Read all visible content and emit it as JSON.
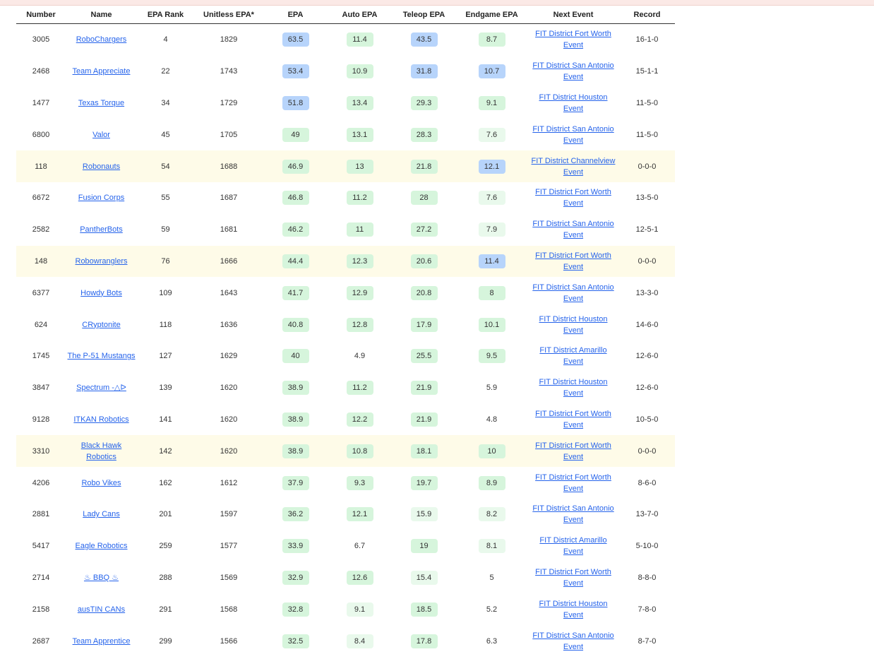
{
  "headers": {
    "number": "Number",
    "name": "Name",
    "epa_rank": "EPA Rank",
    "unitless_epa": "Unitless EPA*",
    "epa": "EPA",
    "auto_epa": "Auto EPA",
    "teleop_epa": "Teleop EPA",
    "endgame_epa": "Endgame EPA",
    "next_event": "Next Event",
    "record": "Record"
  },
  "colors": {
    "chip_blue": "#b7d4fb",
    "chip_green": "#d6f5dc",
    "chip_light_green": "#e9f9ec",
    "link": "#2563eb",
    "highlight_row": "#fefbe8"
  },
  "rows": [
    {
      "number": "3005",
      "name": "RoboChargers",
      "rank": "4",
      "unitless": "1829",
      "epa": "63.5",
      "epa_c": "blue",
      "auto": "11.4",
      "auto_c": "green",
      "teleop": "43.5",
      "teleop_c": "blue",
      "endgame": "8.7",
      "endgame_c": "green",
      "event": "FIT District Fort Worth Event",
      "record": "16-1-0",
      "hl": false
    },
    {
      "number": "2468",
      "name": "Team Appreciate",
      "rank": "22",
      "unitless": "1743",
      "epa": "53.4",
      "epa_c": "blue",
      "auto": "10.9",
      "auto_c": "green",
      "teleop": "31.8",
      "teleop_c": "blue",
      "endgame": "10.7",
      "endgame_c": "blue",
      "event": "FIT District San Antonio Event",
      "record": "15-1-1",
      "hl": false
    },
    {
      "number": "1477",
      "name": "Texas Torque",
      "rank": "34",
      "unitless": "1729",
      "epa": "51.8",
      "epa_c": "blue",
      "auto": "13.4",
      "auto_c": "green",
      "teleop": "29.3",
      "teleop_c": "green",
      "endgame": "9.1",
      "endgame_c": "green",
      "event": "FIT District Houston Event",
      "record": "11-5-0",
      "hl": false
    },
    {
      "number": "6800",
      "name": "Valor",
      "rank": "45",
      "unitless": "1705",
      "epa": "49",
      "epa_c": "green",
      "auto": "13.1",
      "auto_c": "green",
      "teleop": "28.3",
      "teleop_c": "green",
      "endgame": "7.6",
      "endgame_c": "lgreen",
      "event": "FIT District San Antonio Event",
      "record": "11-5-0",
      "hl": false
    },
    {
      "number": "118",
      "name": "Robonauts",
      "rank": "54",
      "unitless": "1688",
      "epa": "46.9",
      "epa_c": "green",
      "auto": "13",
      "auto_c": "green",
      "teleop": "21.8",
      "teleop_c": "green",
      "endgame": "12.1",
      "endgame_c": "blue",
      "event": "FIT District Channelview Event",
      "record": "0-0-0",
      "hl": true
    },
    {
      "number": "6672",
      "name": "Fusion Corps",
      "rank": "55",
      "unitless": "1687",
      "epa": "46.8",
      "epa_c": "green",
      "auto": "11.2",
      "auto_c": "green",
      "teleop": "28",
      "teleop_c": "green",
      "endgame": "7.6",
      "endgame_c": "lgreen",
      "event": "FIT District Fort Worth Event",
      "record": "13-5-0",
      "hl": false
    },
    {
      "number": "2582",
      "name": "PantherBots",
      "rank": "59",
      "unitless": "1681",
      "epa": "46.2",
      "epa_c": "green",
      "auto": "11",
      "auto_c": "green",
      "teleop": "27.2",
      "teleop_c": "green",
      "endgame": "7.9",
      "endgame_c": "lgreen",
      "event": "FIT District San Antonio Event",
      "record": "12-5-1",
      "hl": false
    },
    {
      "number": "148",
      "name": "Robowranglers",
      "rank": "76",
      "unitless": "1666",
      "epa": "44.4",
      "epa_c": "green",
      "auto": "12.3",
      "auto_c": "green",
      "teleop": "20.6",
      "teleop_c": "green",
      "endgame": "11.4",
      "endgame_c": "blue",
      "event": "FIT District Fort Worth Event",
      "record": "0-0-0",
      "hl": true
    },
    {
      "number": "6377",
      "name": "Howdy Bots",
      "rank": "109",
      "unitless": "1643",
      "epa": "41.7",
      "epa_c": "green",
      "auto": "12.9",
      "auto_c": "green",
      "teleop": "20.8",
      "teleop_c": "green",
      "endgame": "8",
      "endgame_c": "green",
      "event": "FIT District San Antonio Event",
      "record": "13-3-0",
      "hl": false
    },
    {
      "number": "624",
      "name": "CRyptonite",
      "rank": "118",
      "unitless": "1636",
      "epa": "40.8",
      "epa_c": "green",
      "auto": "12.8",
      "auto_c": "green",
      "teleop": "17.9",
      "teleop_c": "green",
      "endgame": "10.1",
      "endgame_c": "green",
      "event": "FIT District Houston Event",
      "record": "14-6-0",
      "hl": false
    },
    {
      "number": "1745",
      "name": "The P-51 Mustangs",
      "rank": "127",
      "unitless": "1629",
      "epa": "40",
      "epa_c": "green",
      "auto": "4.9",
      "auto_c": "none",
      "teleop": "25.5",
      "teleop_c": "green",
      "endgame": "9.5",
      "endgame_c": "green",
      "event": "FIT District Amarillo Event",
      "record": "12-6-0",
      "hl": false
    },
    {
      "number": "3847",
      "name": "Spectrum -△ᐅ",
      "rank": "139",
      "unitless": "1620",
      "epa": "38.9",
      "epa_c": "green",
      "auto": "11.2",
      "auto_c": "green",
      "teleop": "21.9",
      "teleop_c": "green",
      "endgame": "5.9",
      "endgame_c": "none",
      "event": "FIT District Houston Event",
      "record": "12-6-0",
      "hl": false
    },
    {
      "number": "9128",
      "name": "ITKAN Robotics",
      "rank": "141",
      "unitless": "1620",
      "epa": "38.9",
      "epa_c": "green",
      "auto": "12.2",
      "auto_c": "green",
      "teleop": "21.9",
      "teleop_c": "green",
      "endgame": "4.8",
      "endgame_c": "none",
      "event": "FIT District Fort Worth Event",
      "record": "10-5-0",
      "hl": false
    },
    {
      "number": "3310",
      "name": "Black Hawk Robotics",
      "rank": "142",
      "unitless": "1620",
      "epa": "38.9",
      "epa_c": "green",
      "auto": "10.8",
      "auto_c": "green",
      "teleop": "18.1",
      "teleop_c": "green",
      "endgame": "10",
      "endgame_c": "green",
      "event": "FIT District Fort Worth Event",
      "record": "0-0-0",
      "hl": true
    },
    {
      "number": "4206",
      "name": "Robo Vikes",
      "rank": "162",
      "unitless": "1612",
      "epa": "37.9",
      "epa_c": "green",
      "auto": "9.3",
      "auto_c": "green",
      "teleop": "19.7",
      "teleop_c": "green",
      "endgame": "8.9",
      "endgame_c": "green",
      "event": "FIT District Fort Worth Event",
      "record": "8-6-0",
      "hl": false
    },
    {
      "number": "2881",
      "name": "Lady Cans",
      "rank": "201",
      "unitless": "1597",
      "epa": "36.2",
      "epa_c": "green",
      "auto": "12.1",
      "auto_c": "green",
      "teleop": "15.9",
      "teleop_c": "lgreen",
      "endgame": "8.2",
      "endgame_c": "lgreen",
      "event": "FIT District San Antonio Event",
      "record": "13-7-0",
      "hl": false
    },
    {
      "number": "5417",
      "name": "Eagle Robotics",
      "rank": "259",
      "unitless": "1577",
      "epa": "33.9",
      "epa_c": "green",
      "auto": "6.7",
      "auto_c": "none",
      "teleop": "19",
      "teleop_c": "green",
      "endgame": "8.1",
      "endgame_c": "lgreen",
      "event": "FIT District Amarillo Event",
      "record": "5-10-0",
      "hl": false
    },
    {
      "number": "2714",
      "name": "♨ BBQ ♨",
      "rank": "288",
      "unitless": "1569",
      "epa": "32.9",
      "epa_c": "green",
      "auto": "12.6",
      "auto_c": "green",
      "teleop": "15.4",
      "teleop_c": "lgreen",
      "endgame": "5",
      "endgame_c": "none",
      "event": "FIT District Fort Worth Event",
      "record": "8-8-0",
      "hl": false
    },
    {
      "number": "2158",
      "name": "ausTIN CANs",
      "rank": "291",
      "unitless": "1568",
      "epa": "32.8",
      "epa_c": "green",
      "auto": "9.1",
      "auto_c": "lgreen",
      "teleop": "18.5",
      "teleop_c": "green",
      "endgame": "5.2",
      "endgame_c": "none",
      "event": "FIT District Houston Event",
      "record": "7-8-0",
      "hl": false
    },
    {
      "number": "2687",
      "name": "Team Apprentice",
      "rank": "299",
      "unitless": "1566",
      "epa": "32.5",
      "epa_c": "green",
      "auto": "8.4",
      "auto_c": "lgreen",
      "teleop": "17.8",
      "teleop_c": "green",
      "endgame": "6.3",
      "endgame_c": "none",
      "event": "FIT District San Antonio Event",
      "record": "8-7-0",
      "hl": false
    }
  ]
}
